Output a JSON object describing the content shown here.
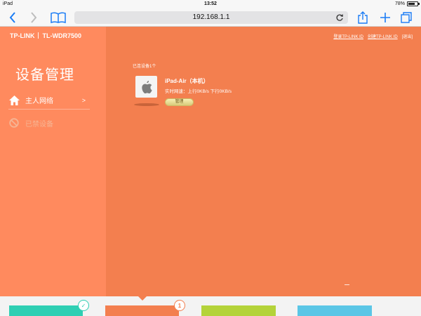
{
  "status_bar": {
    "device": "iPad",
    "time": "13:52",
    "battery": "78%",
    "battery_level": 0.78
  },
  "browser": {
    "url": "192.168.1.1",
    "accent": "#1a7cf5"
  },
  "router": {
    "brand": "TP-LINK",
    "model": "TL-WDR7500",
    "links": {
      "login": "登录TP-LINK ID",
      "create": "创建TP-LINK ID",
      "logout": "[退出]"
    },
    "sidebar": {
      "title": "设备管理",
      "items": [
        {
          "label": "主人网络",
          "chevron": ">",
          "icon": "home-icon"
        },
        {
          "label": "已禁设备",
          "icon": "ban-icon"
        }
      ]
    },
    "main": {
      "connected_count": "已连设备1个",
      "devices": [
        {
          "name": "iPad-Air（本机）",
          "speed": "实时网速：上行0KB/s  下行0KB/s",
          "manage_label": "管理",
          "icon": "apple-icon"
        }
      ]
    },
    "tiles": [
      {
        "color": "#2fcfb3",
        "badge": "✓",
        "icon": "check-icon"
      },
      {
        "color": "#f37f4f",
        "badge": "1"
      },
      {
        "color": "#b4d33a"
      },
      {
        "color": "#5bc6e6"
      }
    ]
  }
}
